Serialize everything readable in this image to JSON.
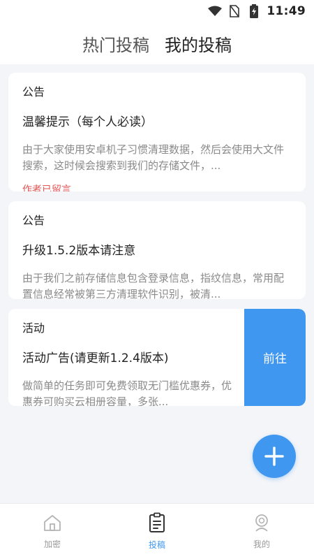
{
  "status_bar": {
    "time": "11:49"
  },
  "tabs": [
    {
      "label": "热门投稿"
    },
    {
      "label": "我的投稿"
    }
  ],
  "posts": [
    {
      "category": "公告",
      "title": "温馨提示（每个人必读）",
      "summary": "由于大家使用安卓机子习惯清理数据，然后会使用大文件搜索，这时候会搜索到我们的存储文件，...",
      "note": "作者已留言"
    },
    {
      "category": "公告",
      "title": "升级1.5.2版本请注意",
      "summary": "由于我们之前存储信息包含登录信息，指纹信息，常用配置信息经常被第三方清理软件识别，被清..."
    },
    {
      "category": "活动",
      "title": "活动广告(请更新1.2.4版本)",
      "summary": "做简单的任务即可免费领取无门槛优惠券，优惠券可购买云相册容量，多张...",
      "action_label": "前往"
    }
  ],
  "bottom_nav": [
    {
      "label": "加密",
      "icon": "home-icon"
    },
    {
      "label": "投稿",
      "icon": "clipboard-icon"
    },
    {
      "label": "我的",
      "icon": "profile-icon"
    }
  ],
  "colors": {
    "accent": "#3f97f0",
    "note": "#e05555"
  }
}
